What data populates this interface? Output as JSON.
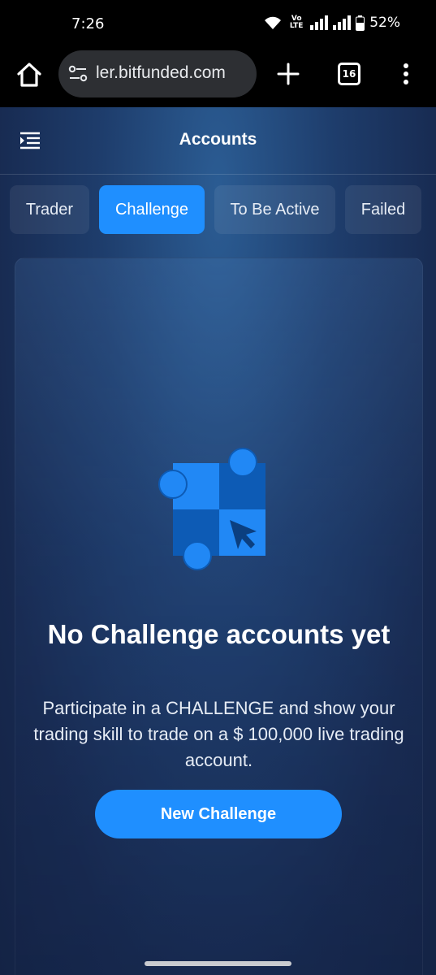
{
  "status_bar": {
    "time": "7:26",
    "network_label": "Vo\nLTE",
    "battery": "52%"
  },
  "browser": {
    "url": "ler.bitfunded.com",
    "tab_count": "16",
    "icons": [
      "home-icon",
      "site-settings-icon",
      "plus-icon",
      "tabs-icon",
      "more-vert-icon"
    ]
  },
  "header": {
    "title": "Accounts",
    "menu_icon": "sidebar-menu-icon"
  },
  "tabs": [
    {
      "label": "Trader",
      "active": false
    },
    {
      "label": "Challenge",
      "active": true
    },
    {
      "label": "To Be Active",
      "active": false
    },
    {
      "label": "Failed",
      "active": false
    }
  ],
  "empty_state": {
    "icon": "puzzle-cursor-icon",
    "title": "No Challenge accounts yet",
    "description": "Participate in a CHALLENGE and show your trading skill to trade on a $ 100,000 live trading account.",
    "button_label": "New Challenge"
  },
  "colors": {
    "accent": "#1f8fff",
    "background_dark": "#16264d",
    "illustration_light": "#2188f5",
    "illustration_dark": "#0d5bb5"
  }
}
